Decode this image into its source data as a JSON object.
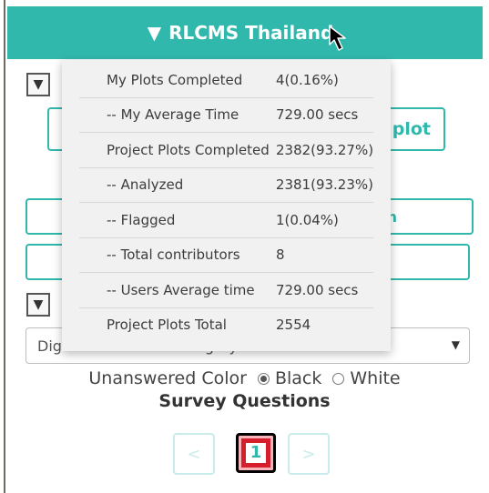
{
  "header": {
    "toggle_icon": "▼",
    "title": "RLCMS Thailand"
  },
  "sidebar": {
    "collapse_icon": "▼",
    "plot_button_label": "plot",
    "button_partial_label": "n",
    "imagery_select": {
      "selected": "DigitalGlobeRecentImagery"
    },
    "unanswered_color": {
      "label": "Unanswered Color",
      "options": [
        "Black",
        "White"
      ],
      "selected": "Black"
    },
    "survey_title": "Survey Questions",
    "pager": {
      "prev": "<",
      "current": "1",
      "next": ">"
    }
  },
  "stats": {
    "rows": [
      {
        "label": "My Plots Completed",
        "value": "4(0.16%)"
      },
      {
        "label": "-- My Average Time",
        "value": "729.00 secs"
      },
      {
        "label": "Project Plots Completed",
        "value": "2382(93.27%)"
      },
      {
        "label": "-- Analyzed",
        "value": "2381(93.23%)"
      },
      {
        "label": "-- Flagged",
        "value": "1(0.04%)"
      },
      {
        "label": "-- Total contributors",
        "value": "8"
      },
      {
        "label": "-- Users Average time",
        "value": "729.00 secs"
      },
      {
        "label": "Project Plots Total",
        "value": "2554"
      }
    ]
  },
  "colors": {
    "accent": "#31b8ad",
    "popover_bg": "#f1f1f1",
    "current_page_red": "#d61f2c"
  }
}
